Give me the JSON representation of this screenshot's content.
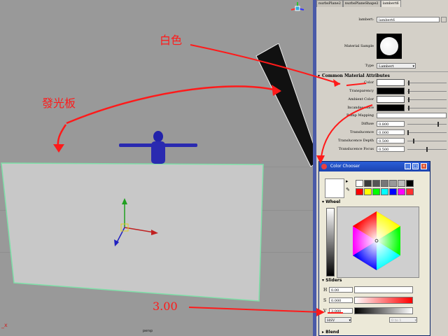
{
  "viewport": {
    "camera_label": "persp",
    "axis_marker": "_x"
  },
  "attribute_editor": {
    "tabs": [
      "nurbsPlane2",
      "nurbsPlaneShape2",
      "lambert6"
    ],
    "active_tab": 2,
    "material_label": "lambert:",
    "material_name": "lambert6",
    "sample_label": "Material Sample",
    "type_label": "Type",
    "type_value": "Lambert",
    "section_title": "Common Material Attributes",
    "attributes": [
      {
        "label": "Color",
        "kind": "swatch",
        "color": "#ffffff",
        "slider": 0.02
      },
      {
        "label": "Transparency",
        "kind": "swatch",
        "color": "#000000",
        "slider": 0.02
      },
      {
        "label": "Ambient Color",
        "kind": "swatch",
        "color": "#ffffff",
        "slider": 0.02
      },
      {
        "label": "Incandescence",
        "kind": "swatch",
        "color": "#000000",
        "slider": 0.02
      },
      {
        "label": "Bump Mapping",
        "kind": "empty"
      },
      {
        "label": "Diffuse",
        "kind": "value",
        "value": "0.800",
        "slider": 0.8
      },
      {
        "label": "Translucence",
        "kind": "value",
        "value": "0.000",
        "slider": 0.0
      },
      {
        "label": "Translucence Depth",
        "kind": "value",
        "value": "0.500",
        "slider": 0.15
      },
      {
        "label": "Translucence Focus",
        "kind": "value",
        "value": "0.500",
        "slider": 0.5
      }
    ]
  },
  "color_chooser": {
    "title": "Color Chooser",
    "palette": [
      "#ffffff",
      "#3a3a3a",
      "#555555",
      "#777777",
      "#999999",
      "#bbbbbb",
      "#000000",
      "#ff0000",
      "#ffff00",
      "#00ff00",
      "#00ffff",
      "#0000ff",
      "#ff00ff",
      "#ff3030"
    ],
    "wheel_label": "Wheel",
    "sliders_label": "Sliders",
    "sliders": [
      {
        "label": "H",
        "value": "0.00"
      },
      {
        "label": "S",
        "value": "0.000"
      },
      {
        "label": "V",
        "value": "3.000"
      }
    ],
    "mode": "HSV",
    "range": "0 to 1",
    "blend_label": "Blend"
  },
  "annotations": {
    "white": "白色",
    "light_board": "發光板",
    "value": "3.00"
  }
}
